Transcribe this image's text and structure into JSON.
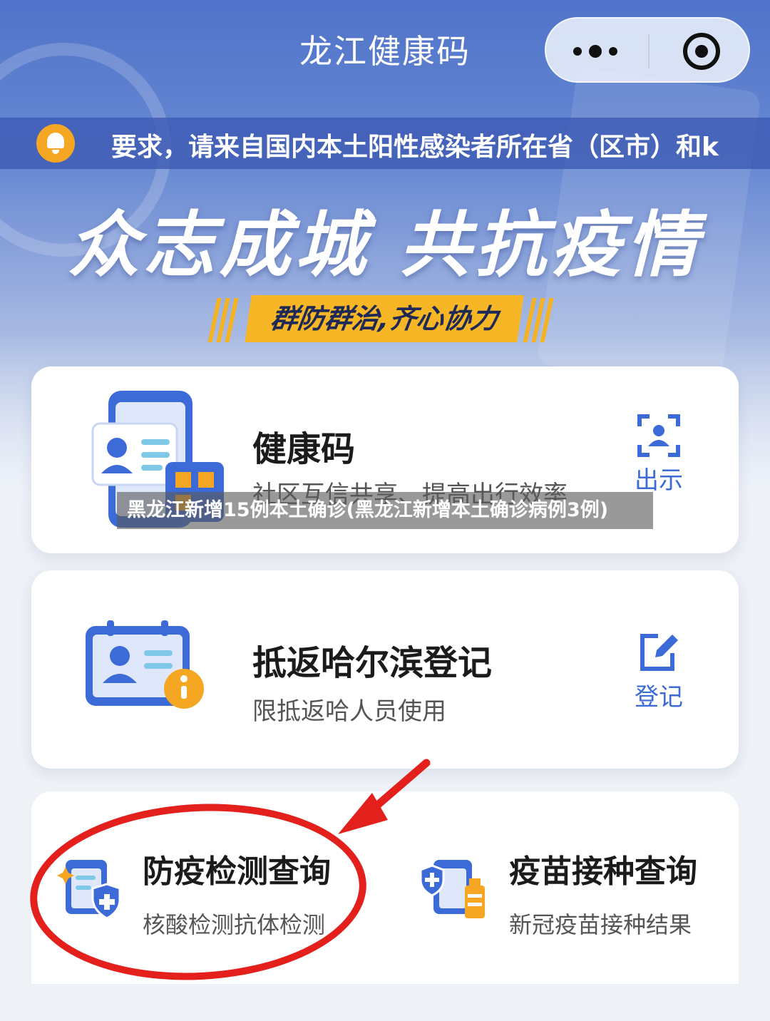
{
  "header": {
    "title": "龙江健康码",
    "more_icon": "more-dots-icon",
    "close_icon": "target-circle-icon"
  },
  "notice": {
    "icon": "bell-icon",
    "text": "要求，请来自国内本土阳性感染者所在省（区市）和k"
  },
  "banner": {
    "slogan": "众志成城 共抗疫情",
    "subslogan": "群防群治,齐心协力"
  },
  "cards": [
    {
      "title": "健康码",
      "subtitle": "社区互信共享、提高出行效率",
      "action_label": "出示",
      "action_icon": "scan-face-icon",
      "illustration": "phone-id-card-icon"
    },
    {
      "title": "抵返哈尔滨登记",
      "subtitle": "限抵返哈人员使用",
      "action_label": "登记",
      "action_icon": "edit-icon",
      "illustration": "id-card-info-icon"
    }
  ],
  "features": [
    {
      "title": "防疫检测查询",
      "subtitle": "核酸检测抗体检测",
      "icon": "test-report-shield-icon"
    },
    {
      "title": "疫苗接种查询",
      "subtitle": "新冠疫苗接种结果",
      "icon": "vaccine-shield-icon"
    }
  ],
  "caption": "黑龙江新增15例本土确诊(黑龙江新增本土确诊病例3例)",
  "colors": {
    "header_blue": "#4f73c9",
    "accent_blue": "#3c6ad6",
    "banner_yellow": "#f6b626",
    "annotation_red": "#e3201b",
    "bell_orange": "#f5a623"
  }
}
